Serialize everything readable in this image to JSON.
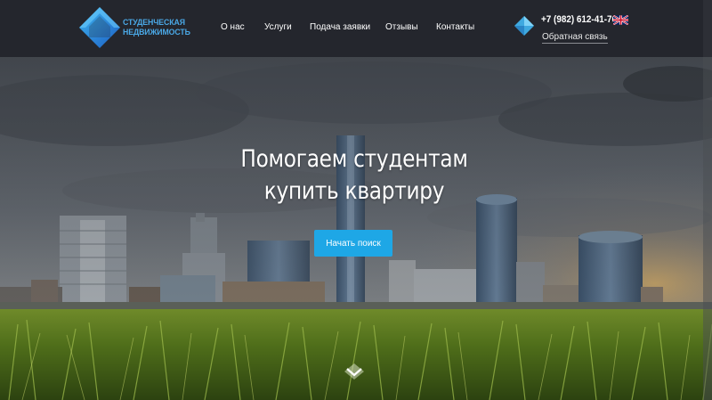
{
  "header": {
    "logo": {
      "line1": "СТУДЕНЧЕСКАЯ",
      "line2": "НЕДВИЖИМОСТЬ"
    },
    "nav": [
      {
        "label": "О нас"
      },
      {
        "label": "Услуги"
      },
      {
        "label": "Подача заявки"
      },
      {
        "label": "Отзывы"
      },
      {
        "label": "Контакты"
      }
    ],
    "phone": "+7 (982) 612-41-76",
    "feedback_label": "Обратная связь",
    "language_icon": "uk-flag-icon"
  },
  "hero": {
    "title_line1": "Помогаем студентам",
    "title_line2": "купить квартиру",
    "cta_label": "Начать поиск",
    "scroll_icon": "chevron-down-icon"
  },
  "colors": {
    "header_bg": "#24262d",
    "accent": "#1ea7e6",
    "logo_blue": "#4aa8e6"
  }
}
